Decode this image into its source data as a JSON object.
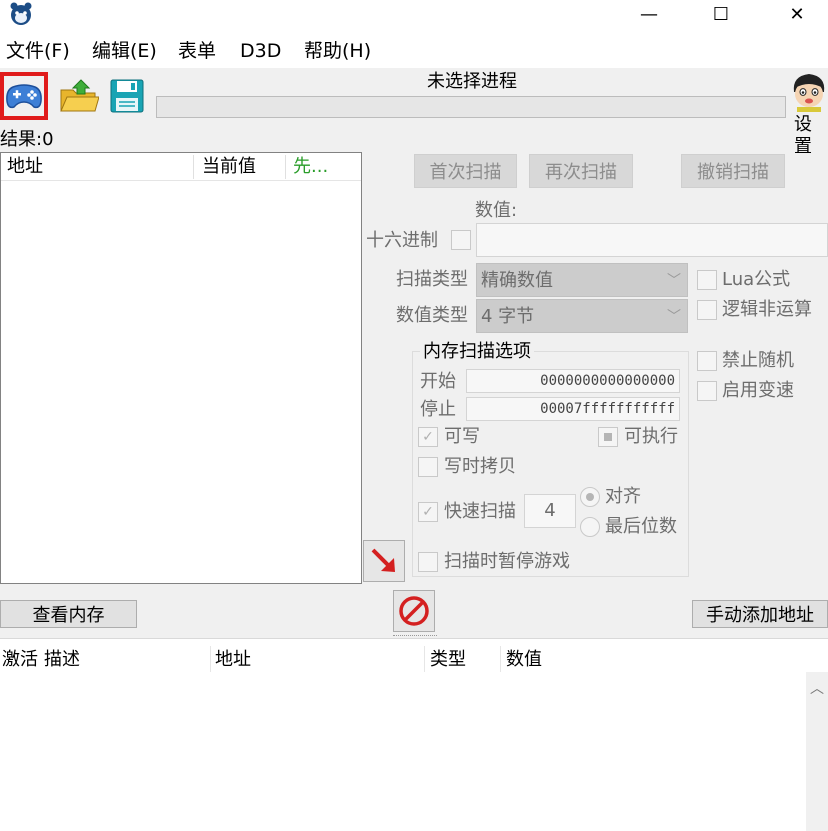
{
  "window": {
    "minimize_glyph": "—",
    "maximize_glyph": "☐",
    "close_glyph": "✕"
  },
  "menu": {
    "items": [
      "文件(F)",
      "编辑(E)",
      "表单",
      "D3D",
      "帮助(H)"
    ]
  },
  "toolbar": {
    "process_label": "未选择进程",
    "settings_label": "设置",
    "icons": [
      "gamepad-icon",
      "folder-open-icon",
      "save-disk-icon"
    ]
  },
  "results": {
    "label": "结果:0",
    "columns": [
      "地址",
      "当前值",
      "先..."
    ]
  },
  "scan": {
    "first_scan": "首次扫描",
    "next_scan": "再次扫描",
    "undo_scan": "撤销扫描",
    "value_label": "数值:",
    "hex_label": "十六进制",
    "scan_type_label": "扫描类型",
    "scan_type_value": "精确数值",
    "value_type_label": "数值类型",
    "value_type_value": "4 字节",
    "lua_label": "Lua公式",
    "not_label": "逻辑非运算",
    "no_random_label": "禁止随机",
    "speedhack_label": "启用变速"
  },
  "memory_options": {
    "title": "内存扫描选项",
    "start_label": "开始",
    "start_value": "0000000000000000",
    "stop_label": "停止",
    "stop_value": "00007fffffffffff",
    "writable_label": "可写",
    "executable_label": "可执行",
    "copy_on_write_label": "写时拷贝",
    "fast_scan_label": "快速扫描",
    "fast_scan_value": "4",
    "align_label": "对齐",
    "last_digits_label": "最后位数",
    "pause_label": "扫描时暂停游戏"
  },
  "actions": {
    "view_memory": "查看内存",
    "add_address": "手动添加地址"
  },
  "address_table": {
    "columns": [
      "激活",
      "描述",
      "地址",
      "类型",
      "数值"
    ]
  },
  "colors": {
    "selected_border": "#e01b1b",
    "arrow_red": "#d42020",
    "stop_red": "#d42020",
    "green_header": "#2a9d2a"
  }
}
